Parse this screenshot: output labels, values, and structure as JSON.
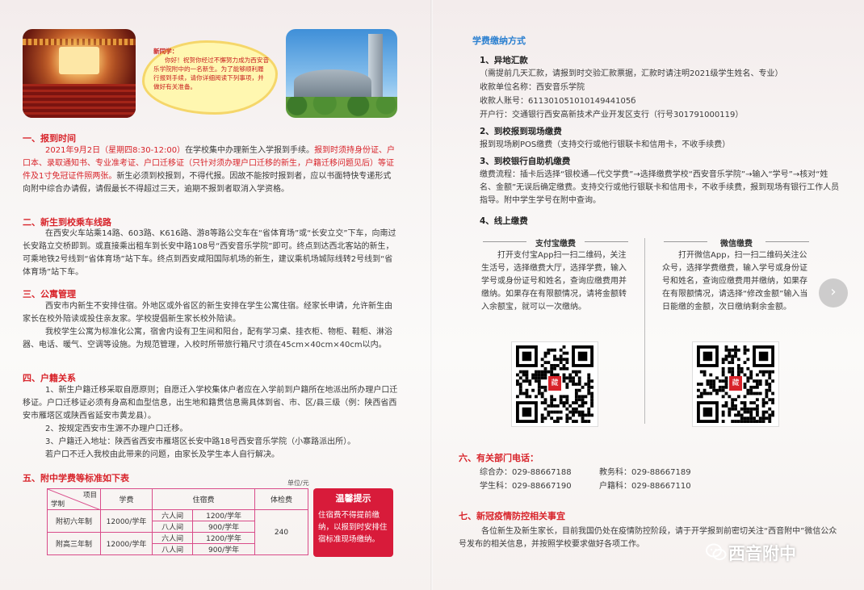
{
  "greeting": {
    "title": "新同学：",
    "body": "你好！祝贺你经过不懈努力成为西安音乐学院附中的一名新生。为了能够顺利履行报到手续，请你详细阅读下列事项，并做好有关准备。"
  },
  "section1": {
    "title": "一、报到时间",
    "p_date": "2021年9月2日（星期四8:30-12:00）",
    "p_mid": "在学校集中办理新生入学报到手续。",
    "p_red1": "报到时须持身份证、户口本、录取通知书、专业准考证、户口迁移证（只针对须办理户口迁移的新生，户籍迁移问题见后）等证件及1寸免冠证件照两张。",
    "p_rest": "新生必须到校报到，不得代报。因故不能按时报到者，应以书面特快专递形式向附中综合办请假，请假最长不得超过三天，逾期不报到者取消入学资格。"
  },
  "section2": {
    "title": "二、新生到校乘车线路",
    "body": "在西安火车站乘14路、603路、K616路、游8等路公交车在“省体育场”或“长安立交”下车，向南过长安路立交桥即到。或直接乘出租车到长安中路108号“西安音乐学院”即可。终点到达西北客站的新生，可乘地铁2号线到“省体育场”站下车。终点到西安咸阳国际机场的新生，建议乘机场城际线转2号线到“省体育场”站下车。"
  },
  "section3": {
    "title": "三、公寓管理",
    "p1": "西安市内新生不安排住宿。外地区或外省区的新生安排在学生公寓住宿。经家长申请，允许新生由家长在校外陪读或投住亲友家。学校提倡新生家长校外陪读。",
    "p2": "我校学生公寓为标准化公寓，宿舍内设有卫生间和阳台，配有学习桌、挂衣柜、物柜、鞋柜、淋浴器、电话、暖气、空调等设施。为规范管理，入校时所带旅行箱尺寸须在45cm×40cm×40cm以内。"
  },
  "section4": {
    "title": "四、户籍关系",
    "p1": "1、新生户籍迁移采取自愿原则；自愿迁入学校集体户者应在入学前到户籍所在地派出所办理户口迁移证。户口迁移证必须有身高和血型信息，出生地和籍贯信息需具体到省、市、区/县三级（例：陕西省西安市雁塔区或陕西省延安市黄龙县）。",
    "p2": "2、按规定西安市生源不办理户口迁移。",
    "p3": "3、户籍迁入地址：陕西省西安市雁塔区长安中路18号西安音乐学院（小寨路派出所）。",
    "p4": "若户口不迁入我校由此带来的问题，由家长及学生本人自行解决。"
  },
  "section5": {
    "title": "五、附中学费等标准如下表",
    "unit": "单位/元",
    "header_item": "项目",
    "header_system": "学制",
    "header_tuition": "学费",
    "header_dorm": "住宿费",
    "header_exam": "体检费",
    "rows": [
      {
        "system": "附初六年制",
        "tuition": "12000/学年",
        "dorm": [
          [
            "六人间",
            "1200/学年"
          ],
          [
            "八人间",
            "900/学年"
          ]
        ]
      },
      {
        "system": "附高三年制",
        "tuition": "12000/学年",
        "dorm": [
          [
            "六人间",
            "1200/学年"
          ],
          [
            "八人间",
            "900/学年"
          ]
        ]
      }
    ],
    "exam_fee": "240",
    "tip_title": "温馨提示",
    "tip_body": "住宿费不得提前缴纳，以报到时安排住宿标准现场缴纳。"
  },
  "payment": {
    "title": "学费缴纳方式",
    "m1_title": "1、异地汇款",
    "m1_note": "（需提前几天汇款，请报到时交验汇款票据，汇款时请注明2021级学生姓名、专业）",
    "m1_unit": "收款单位名称：西安音乐学院",
    "m1_account": "收款人账号：61130105101014944105б",
    "m1_bank": "开户行：交通银行西安高新技术产业开发区支行（行号301791000119）",
    "m2_title": "2、到校报到现场缴费",
    "m2_body": "报到现场刷POS缴费（支持交行或他行银联卡和信用卡，不收手续费）",
    "m3_title": "3、到校银行自助机缴费",
    "m3_body": "缴费流程：插卡后选择“银校通—代交学费”→选择缴费学校“西安音乐学院”→输入“学号”→核对“姓名、金额”无误后确定缴费。支持交行或他行银联卡和信用卡，不收手续费，报到现场有银行工作人员指导。附中学生学号在附中查询。",
    "m4_title": "4、线上缴费",
    "alipay_title": "支付宝缴费",
    "alipay_body": "打开支付宝App扫一扫二维码，关注生活号，选择缴费大厅，选择学费，输入学号或身份证号和姓名，查询应缴费用并缴纳。如果存在有限额情况，请将金额转入余额宝，就可以一次缴纳。",
    "wechat_title": "微信缴费",
    "wechat_body": "打开微信App，扫一扫二维码关注公众号，选择学费缴费，输入学号或身份证号和姓名，查询应缴费用并缴纳，如果存在有限额情况，请选择“修改金额”输入当日能缴的金额，次日缴纳剩余金额。",
    "qr_badge": "藏"
  },
  "section6": {
    "title": "六、有关部门电话：",
    "phones": [
      "综合办：029-88667188",
      "教务科：029-88667189",
      "学生科：029-88667190",
      "户籍科：029-88667110"
    ]
  },
  "section7": {
    "title": "七、新冠疫情防控相关事宜",
    "body": "各位新生及新生家长，目前我国仍处在疫情防控阶段，请于开学报到前密切关注“西音附中”微信公众号发布的相关信息，并按照学校要求做好各项工作。"
  },
  "watermark": "西音附中",
  "next_arrow": "›"
}
